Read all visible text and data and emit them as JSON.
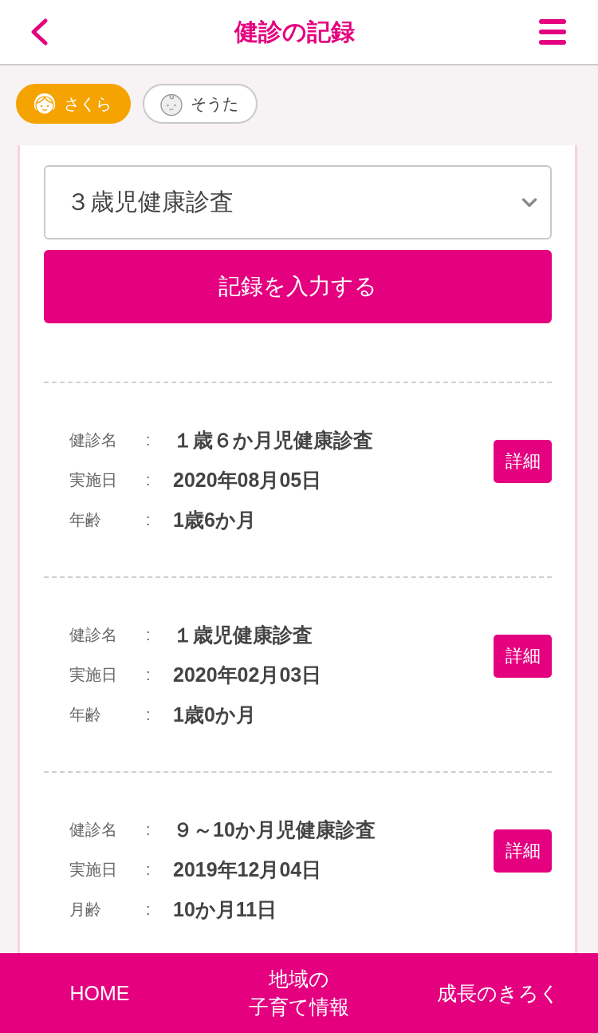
{
  "header": {
    "title": "健診の記録"
  },
  "children": [
    {
      "name": "さくら",
      "kind": "girl",
      "selected": true
    },
    {
      "name": "そうた",
      "kind": "baby",
      "selected": false
    }
  ],
  "exam_select": {
    "value": "３歳児健康診査"
  },
  "input_button": "記録を入力する",
  "records": [
    {
      "fields": [
        {
          "label": "健診名",
          "separator": ":",
          "value": "１歳６か月児健康診査"
        },
        {
          "label": "実施日",
          "separator": ":",
          "value": "2020年08月05日"
        },
        {
          "label": "年齢",
          "separator": ":",
          "value": "1歳6か月"
        }
      ],
      "detail_button": "詳細"
    },
    {
      "fields": [
        {
          "label": "健診名",
          "separator": ":",
          "value": "１歳児健康診査"
        },
        {
          "label": "実施日",
          "separator": ":",
          "value": "2020年02月03日"
        },
        {
          "label": "年齢",
          "separator": ":",
          "value": "1歳0か月"
        }
      ],
      "detail_button": "詳細"
    },
    {
      "fields": [
        {
          "label": "健診名",
          "separator": ":",
          "value": "９～10か月児健康診査"
        },
        {
          "label": "実施日",
          "separator": ":",
          "value": "2019年12月04日"
        },
        {
          "label": "月齢",
          "separator": ":",
          "value": "10か月11日"
        }
      ],
      "detail_button": "詳細"
    }
  ],
  "bottom_nav": [
    {
      "lines": [
        "HOME"
      ]
    },
    {
      "lines": [
        "地域の",
        "子育て情報"
      ]
    },
    {
      "lines": [
        "成長のきろく"
      ]
    }
  ]
}
